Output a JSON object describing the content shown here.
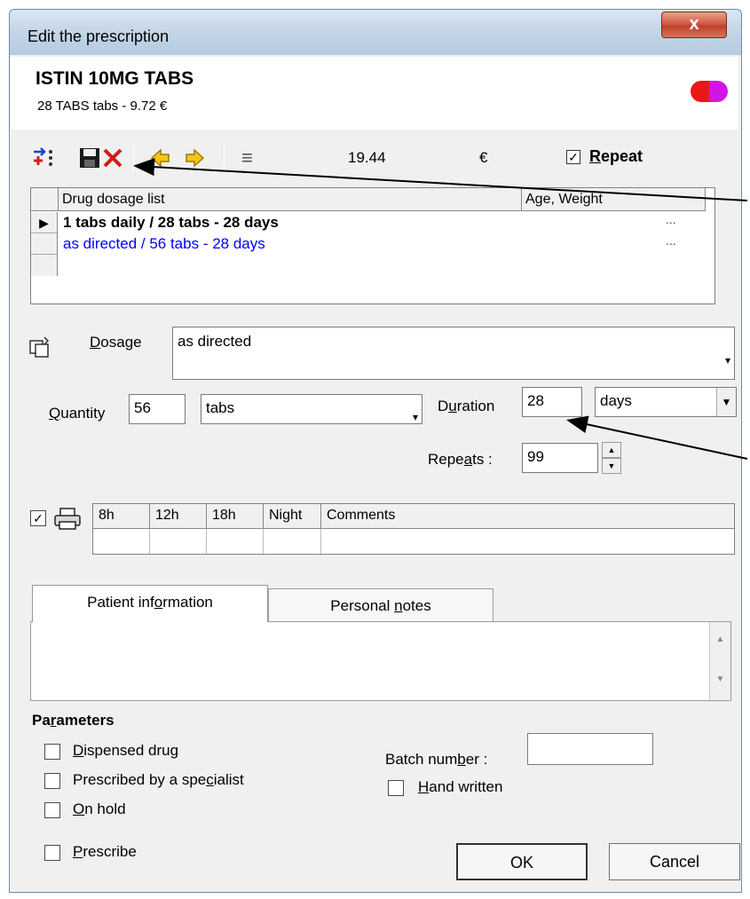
{
  "window": {
    "title": "Edit the prescription",
    "close_glyph": "x"
  },
  "drug": {
    "name": "ISTIN 10MG TABS",
    "summary": "28 TABS tabs - 9.72 €"
  },
  "toolbar": {
    "price": "19.44",
    "currency": "€",
    "repeat_label": "Repeat",
    "repeat_checked": true
  },
  "dosage_list": {
    "columns": [
      "Drug dosage list",
      "Age, Weight"
    ],
    "rows": [
      {
        "text": "1 tabs daily / 28 tabs - 28 days",
        "dots": "...",
        "selected": true,
        "color": "#000000"
      },
      {
        "text": "as  directed / 56 tabs - 28 days",
        "dots": "...",
        "selected": false,
        "color": "#0000ff"
      }
    ]
  },
  "form": {
    "dosage_label": "Dosage",
    "dosage_value": "as  directed",
    "quantity_label": "Quantity",
    "quantity_value": "56",
    "unit_value": "tabs",
    "duration_label": "Duration",
    "duration_value": "28",
    "duration_unit": "days",
    "repeats_label": "Repeats :",
    "repeats_value": "99"
  },
  "schedule": {
    "print_checked": true,
    "columns": [
      "8h",
      "12h",
      "18h",
      "Night",
      "Comments"
    ]
  },
  "tabs": [
    {
      "label": "Patient information",
      "active": true
    },
    {
      "label": "Personal notes",
      "active": false
    }
  ],
  "parameters": {
    "heading": "Parameters",
    "dispensed_drug": "Dispensed drug",
    "prescribed_by_specialist": "Prescribed by a specialist",
    "on_hold": "On hold",
    "prescribe": "Prescribe",
    "batch_number_label": "Batch number :",
    "hand_written": "Hand written"
  },
  "buttons": {
    "ok": "OK",
    "cancel": "Cancel"
  },
  "colors": {
    "title_bar": "#c6d8e9",
    "close_button": "#c0402a",
    "link_blue": "#0000ff",
    "pill_red": "#e81818",
    "pill_magenta": "#d413e5"
  }
}
